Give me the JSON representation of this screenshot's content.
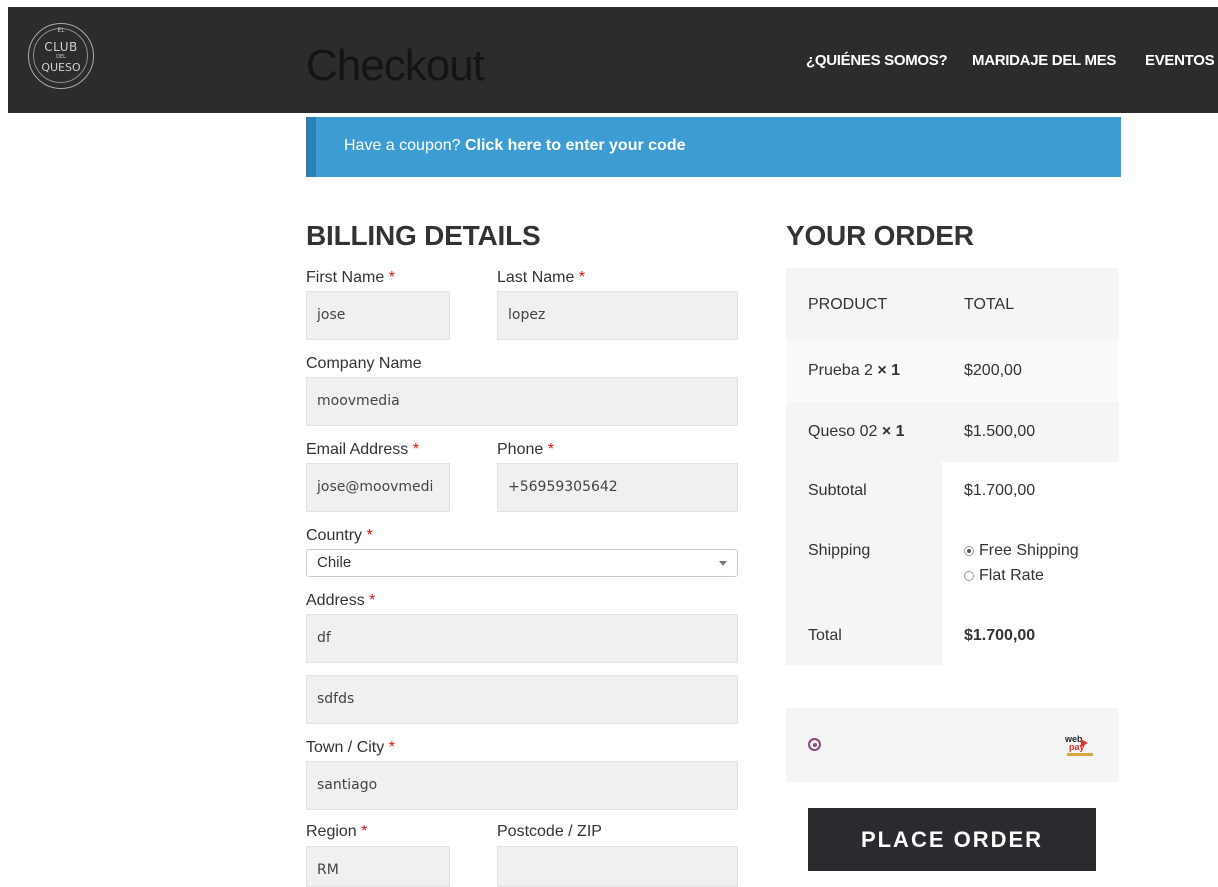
{
  "header": {
    "logo": {
      "el": "EL",
      "club": "CLUB",
      "del": "DEL",
      "queso": "QUESO"
    },
    "title": "Checkout",
    "nav": [
      "¿QUIÉNES SOMOS?",
      "MARIDAJE DEL MES",
      "EVENTOS"
    ]
  },
  "coupon": {
    "prefix": "Have a coupon?",
    "link": "Click here to enter your code"
  },
  "billing": {
    "title": "BILLING DETAILS",
    "required_marker": "*",
    "first_name": {
      "label": "First Name",
      "value": "jose"
    },
    "last_name": {
      "label": "Last Name",
      "value": "lopez"
    },
    "company": {
      "label": "Company Name",
      "value": "moovmedia"
    },
    "email": {
      "label": "Email Address",
      "value": "jose@moovmedi"
    },
    "phone": {
      "label": "Phone",
      "value": "+56959305642"
    },
    "country": {
      "label": "Country",
      "value": "Chile"
    },
    "address": {
      "label": "Address",
      "value1": "df",
      "value2": "sdfds"
    },
    "city": {
      "label": "Town / City",
      "value": "santiago"
    },
    "region": {
      "label": "Region",
      "value": "RM"
    },
    "postcode": {
      "label": "Postcode / ZIP",
      "value": ""
    }
  },
  "order": {
    "title": "YOUR ORDER",
    "header": {
      "product": "PRODUCT",
      "total": "TOTAL"
    },
    "items": [
      {
        "name": "Prueba 2",
        "qty": "× 1",
        "total": "$200,00"
      },
      {
        "name": "Queso 02",
        "qty": "× 1",
        "total": "$1.500,00"
      }
    ],
    "subtotal": {
      "label": "Subtotal",
      "value": "$1.700,00"
    },
    "shipping": {
      "label": "Shipping",
      "options": [
        "Free Shipping",
        "Flat Rate"
      ],
      "selected": "Free Shipping"
    },
    "total": {
      "label": "Total",
      "value": "$1.700,00"
    }
  },
  "payment": {
    "logo_top": "web",
    "logo_bottom": "pay"
  },
  "place_order": "PLACE ORDER",
  "colors": {
    "header_bg": "#2c2c2c",
    "coupon_bg": "#3d9cd2",
    "button_bg": "#2b2b2f",
    "required": "#e01010",
    "payment_radio": "#8a4d76"
  }
}
